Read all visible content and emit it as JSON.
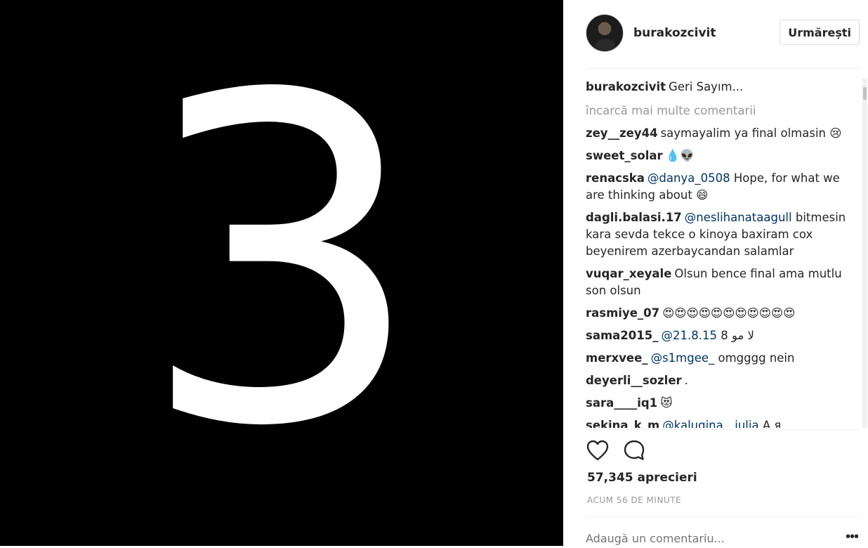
{
  "media": {
    "digit": "3"
  },
  "header": {
    "username": "burakozcivit",
    "follow_label": "Urmărești"
  },
  "caption": {
    "user": "burakozcivit",
    "text": "Geri Sayım..."
  },
  "load_more_label": "încarcă mai multe comentarii",
  "comments": [
    {
      "user": "zey__zey44",
      "mention": "",
      "text": "saymayalim ya final olmasin 😢"
    },
    {
      "user": "sweet_solar",
      "mention": "",
      "text": "💧👽"
    },
    {
      "user": "renacska",
      "mention": "@danya_0508",
      "text": "Hope, for what we are thinking about 😄"
    },
    {
      "user": "dagli.balasi.17",
      "mention": "@neslihanataagull",
      "text": "bitmesin kara sevda tekce o kinoya baxiram cox beyenirem azerbaycandan salamlar"
    },
    {
      "user": "vuqar_xeyale",
      "mention": "",
      "text": "Olsun bence final ama mutlu son olsun"
    },
    {
      "user": "rasmiye_07",
      "mention": "",
      "text": "😍😍😍😍😍😍😍😍😍😍😍"
    },
    {
      "user": "sama2015_",
      "mention": "@21.8.15",
      "text": "لا مو 8"
    },
    {
      "user": "merxvee_",
      "mention": "@s1mgee_",
      "text": "omgggg nein"
    },
    {
      "user": "deyerli__sozler",
      "mention": "",
      "text": "."
    },
    {
      "user": "sara____iq1",
      "mention": "",
      "text": "😻"
    },
    {
      "user": "sekina_k_m",
      "mention": "@kalugina__julia",
      "text": "А я"
    }
  ],
  "likes_text": "57,345 aprecieri",
  "timestamp": "ACUM 56 DE MINUTE",
  "add_comment_placeholder": "Adaugă un comentariu...",
  "more_options": "•••",
  "icons": {
    "like": "heart-outline",
    "comment": "speech-bubble-outline"
  }
}
